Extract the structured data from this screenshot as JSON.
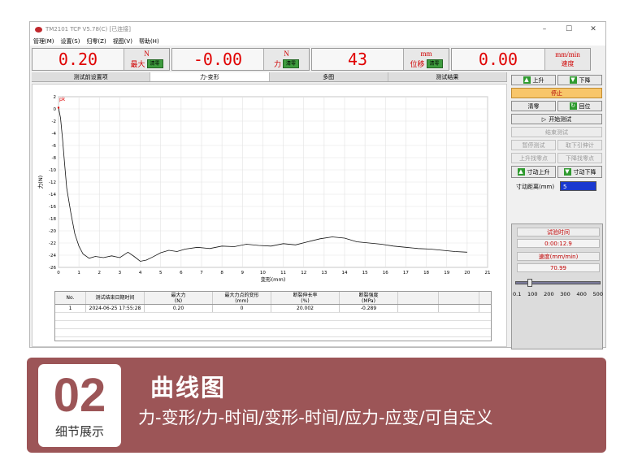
{
  "window": {
    "title": "TM2101  TCP V5.78(C)  [已连接]"
  },
  "menu": [
    "管理(M)",
    "设置(S)",
    "归零(Z)",
    "视图(V)",
    "帮助(H)"
  ],
  "readouts": [
    {
      "value": "0.20",
      "unit": "N",
      "label": "最大",
      "button": "清零"
    },
    {
      "value": "-0.00",
      "unit": "N",
      "label": "力",
      "button": "清零"
    },
    {
      "value": "43",
      "unit": "mm",
      "label": "位移",
      "button": "清零"
    },
    {
      "value": "0.00",
      "unit": "mm/min",
      "label": "速度",
      "button": ""
    }
  ],
  "tabs": [
    "测试前设置项",
    "力-变形",
    "多图",
    "测试结果"
  ],
  "active_tab": 1,
  "right_panel": {
    "up": "上升",
    "down": "下降",
    "stop": "停止",
    "zero": "清零",
    "return": "回位",
    "start": "开始测试",
    "end": "结束测试",
    "pause": "暂停测试",
    "remove_ext": "取下引伸计",
    "up_find": "上升找零点",
    "down_find": "下降找零点",
    "inch_up": "寸动上升",
    "inch_down": "寸动下降",
    "inch_dist_label": "寸动距离(mm)",
    "inch_dist_value": "5",
    "time_label": "试验时间",
    "time_value": "0:00:12.9",
    "speed_label": "速度(mm/min)",
    "speed_value": "70.99",
    "slider_ticks": [
      "0.1",
      "100",
      "200",
      "300",
      "400",
      "500"
    ],
    "slider_level": 0.14
  },
  "chart_data": {
    "type": "line",
    "xlabel": "变形(mm)",
    "ylabel": "力(N)",
    "xlim": [
      0,
      21
    ],
    "ylim": [
      -26,
      2
    ],
    "xticks": [
      0,
      1,
      2,
      3,
      4,
      5,
      6,
      7,
      8,
      9,
      10,
      11,
      12,
      13,
      14,
      15,
      16,
      17,
      18,
      19,
      20,
      21
    ],
    "yticks": [
      2,
      0,
      -2,
      -4,
      -6,
      -8,
      -10,
      -12,
      -14,
      -16,
      -18,
      -20,
      -22,
      -24,
      -26
    ],
    "annotation": "pk",
    "grid": true,
    "series": [
      {
        "x": [
          0,
          0.1,
          0.2,
          0.3,
          0.4,
          0.6,
          0.8,
          1.0,
          1.2,
          1.5,
          1.8,
          2.2,
          2.6,
          3.0,
          3.4,
          3.7,
          4.0,
          4.3,
          4.6,
          5.0,
          5.4,
          5.8,
          6.2,
          6.8,
          7.4,
          8.0,
          8.6,
          9.2,
          9.8,
          10.4,
          11.0,
          11.6,
          12.2,
          12.8,
          13.4,
          14.0,
          14.6,
          15.2,
          15.8,
          16.4,
          17.0,
          17.6,
          18.2,
          18.8,
          19.4,
          20.0
        ],
        "y": [
          0.2,
          -1.5,
          -5,
          -9,
          -13,
          -17,
          -20.5,
          -22.5,
          -23.8,
          -24.5,
          -24.2,
          -24.4,
          -24.1,
          -24.4,
          -23.5,
          -24.2,
          -25.0,
          -24.8,
          -24.3,
          -23.6,
          -23.2,
          -23.4,
          -23.0,
          -22.7,
          -22.9,
          -22.5,
          -22.6,
          -22.2,
          -22.4,
          -22.5,
          -22.1,
          -22.3,
          -21.8,
          -21.3,
          -21.0,
          -21.2,
          -21.8,
          -22.0,
          -22.2,
          -22.5,
          -22.7,
          -22.9,
          -23.0,
          -23.2,
          -23.4,
          -23.5
        ]
      }
    ]
  },
  "table": {
    "headers": [
      "No.",
      "测试结束日期时间",
      "最大力\n(N)",
      "最大力点的变形\n(mm)",
      "断裂伸长率\n(%)",
      "断裂强度\n(MPa)",
      "",
      ""
    ],
    "rows": [
      [
        "1",
        "2024-06-25 17:55:28",
        "0.20",
        "0",
        "20.002",
        "-0.289",
        "",
        ""
      ]
    ]
  },
  "banner": {
    "number": "02",
    "sub": "细节展示",
    "title": "曲线图",
    "desc": "力-变形/力-时间/变形-时间/应力-应变/可自定义",
    "color": "#9c5557"
  }
}
